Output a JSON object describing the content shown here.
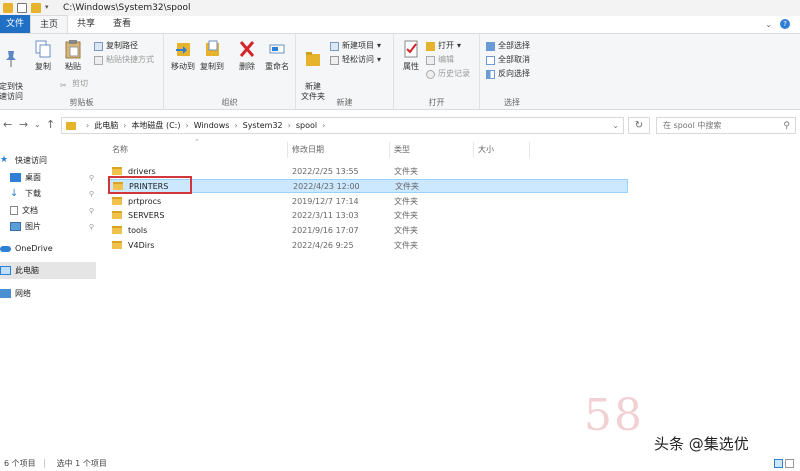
{
  "window": {
    "path": "C:\\Windows\\System32\\spool"
  },
  "tabs": [
    {
      "label": "文件"
    },
    {
      "label": "主页"
    },
    {
      "label": "共享"
    },
    {
      "label": "查看"
    }
  ],
  "ribbon": {
    "clipboard": {
      "group_label": "剪贴板",
      "pin": "定到快\n速访问",
      "copy": "复制",
      "paste": "粘贴",
      "copy_path": "复制路径",
      "paste_shortcut": "粘贴快捷方式",
      "cut": "剪切"
    },
    "organize": {
      "group_label": "组织",
      "move_to": "移动到",
      "copy_to": "复制到",
      "delete": "删除",
      "rename": "重命名"
    },
    "new": {
      "group_label": "新建",
      "new_folder": "新建\n文件夹",
      "new_item": "新建项目",
      "easy_access": "轻松访问"
    },
    "open": {
      "group_label": "打开",
      "properties": "属性",
      "open": "打开",
      "edit": "编辑",
      "history": "历史记录"
    },
    "select": {
      "group_label": "选择",
      "select_all": "全部选择",
      "select_none": "全部取消",
      "invert": "反向选择"
    }
  },
  "address": {
    "crumbs": [
      "此电脑",
      "本地磁盘 (C:)",
      "Windows",
      "System32",
      "spool"
    ],
    "search_placeholder": "在 spool 中搜索"
  },
  "nav": {
    "items": [
      {
        "label": "快速访问"
      },
      {
        "label": "桌面"
      },
      {
        "label": "下载"
      },
      {
        "label": "文档"
      },
      {
        "label": "图片"
      },
      {
        "label": "OneDrive"
      },
      {
        "label": "此电脑"
      },
      {
        "label": "网络"
      }
    ]
  },
  "table": {
    "columns": [
      "名称",
      "修改日期",
      "类型",
      "大小"
    ],
    "rows": [
      {
        "name": "drivers",
        "date": "2022/2/25 13:55",
        "type": "文件夹"
      },
      {
        "name": "PRINTERS",
        "date": "2022/4/23 12:00",
        "type": "文件夹"
      },
      {
        "name": "prtprocs",
        "date": "2019/12/7 17:14",
        "type": "文件夹"
      },
      {
        "name": "SERVERS",
        "date": "2022/3/11 13:03",
        "type": "文件夹"
      },
      {
        "name": "tools",
        "date": "2021/9/16 17:07",
        "type": "文件夹"
      },
      {
        "name": "V4Dirs",
        "date": "2022/4/26 9:25",
        "type": "文件夹"
      }
    ]
  },
  "status": {
    "count": "6 个项目",
    "selected": "选中 1 个项目"
  },
  "watermark": {
    "site": "58",
    "source": "头条 @集选优"
  },
  "colors": {
    "accent": "#1f6fc5",
    "selection": "#cce8ff",
    "highlight": "#d3363a",
    "folder": "#f0c24b"
  }
}
